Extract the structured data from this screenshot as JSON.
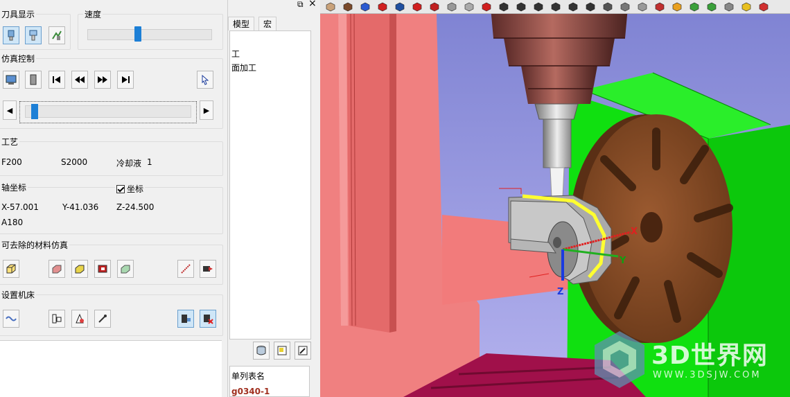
{
  "tool_display": {
    "title": "刀具显示",
    "buttons": [
      "tool-holder-icon",
      "tool-assembly-icon",
      "tool-path-icon"
    ]
  },
  "speed": {
    "title": "速度",
    "level_fraction": 0.4
  },
  "sim_control": {
    "title": "仿真控制",
    "buttons": [
      "setup-icon",
      "part-icon",
      "go-to-start-icon",
      "step-back-icon",
      "step-forward-icon",
      "go-to-end-icon",
      "cursor-icon"
    ],
    "timeline_fraction": 0.03
  },
  "process": {
    "title": "工艺",
    "feed": "F200",
    "spindle": "S2000",
    "coolant_label": "冷却液",
    "coolant_value": "1"
  },
  "axis_coords": {
    "title": "轴坐标",
    "checkbox_label": "坐标",
    "checked": true,
    "x": "X-57.001",
    "y": "Y-41.036",
    "z": "Z-24.500",
    "a": "A180"
  },
  "removal_sim": {
    "title": "可去除的材料仿真",
    "buttons": [
      "stock-icon",
      "stock-shaded-icon",
      "stock-solid-icon",
      "stock-section-icon",
      "stock-transparent-icon",
      "compare-icon",
      "export-icon"
    ]
  },
  "machine_setup": {
    "title": "设置机床",
    "buttons": [
      "kinematics-icon",
      "machine-config-icon",
      "tool-change-icon",
      "probe-icon",
      "machine-view-icon",
      "collision-icon"
    ]
  },
  "mid_panel": {
    "pin_icon": "pin-icon",
    "close_icon": "close-icon",
    "tabs": [
      "模型",
      "宏"
    ],
    "tree_items": [
      "工",
      "面加工"
    ],
    "list_header": "单列表名",
    "list_item": "g0340-1"
  },
  "viewport": {
    "watermark": "3D世界网",
    "watermark_sub": "WWW.3DSJW.COM",
    "axis_labels": {
      "x": "X",
      "y": "Y",
      "z": "Z"
    },
    "colors": {
      "background_top": "#7e82d2",
      "background_bottom": "#b4b2ee",
      "wall": "#f08080",
      "table_green": "#10e010",
      "rotary_table": "#8a4b25",
      "spindle": "#8f4a44",
      "workpiece": "#c8c8c8",
      "toolpath": "#ffff30"
    }
  }
}
